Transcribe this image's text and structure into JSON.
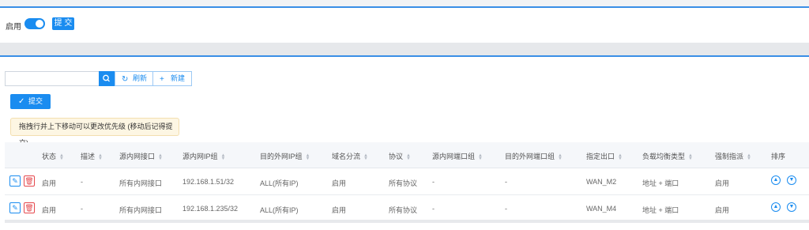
{
  "top": {
    "enable_label": "启用",
    "submit_label": "提 交"
  },
  "toolbar": {
    "search_placeholder": "",
    "refresh_label": "刷新",
    "new_label": "新建",
    "submit_label": "提交"
  },
  "tip": "拖拽行并上下移动可以更改优先级 (移动后记得提交)",
  "table": {
    "headers": [
      "状态",
      "描述",
      "源内网接口",
      "源内网IP组",
      "目的外网IP组",
      "域名分流",
      "协议",
      "源内网端口组",
      "目的外网端口组",
      "指定出口",
      "负载均衡类型",
      "强制指派",
      "排序"
    ],
    "rows": [
      [
        "启用",
        "-",
        "所有内网接口",
        "192.168.1.51/32",
        "ALL(所有IP)",
        "启用",
        "所有协议",
        "-",
        "-",
        "WAN_M2",
        "地址 + 端口",
        "启用"
      ],
      [
        "启用",
        "-",
        "所有内网接口",
        "192.168.1.235/32",
        "ALL(所有IP)",
        "启用",
        "所有协议",
        "-",
        "-",
        "WAN_M4",
        "地址 + 端口",
        "启用"
      ]
    ]
  },
  "colors": {
    "accent": "#1a8cf0",
    "danger": "#e5484d",
    "tip_bg": "#fdf6e3"
  },
  "icons": [
    "search-icon",
    "refresh-icon",
    "plus-icon",
    "check-icon",
    "edit-icon",
    "delete-icon",
    "arrow-up-icon",
    "arrow-down-icon"
  ]
}
